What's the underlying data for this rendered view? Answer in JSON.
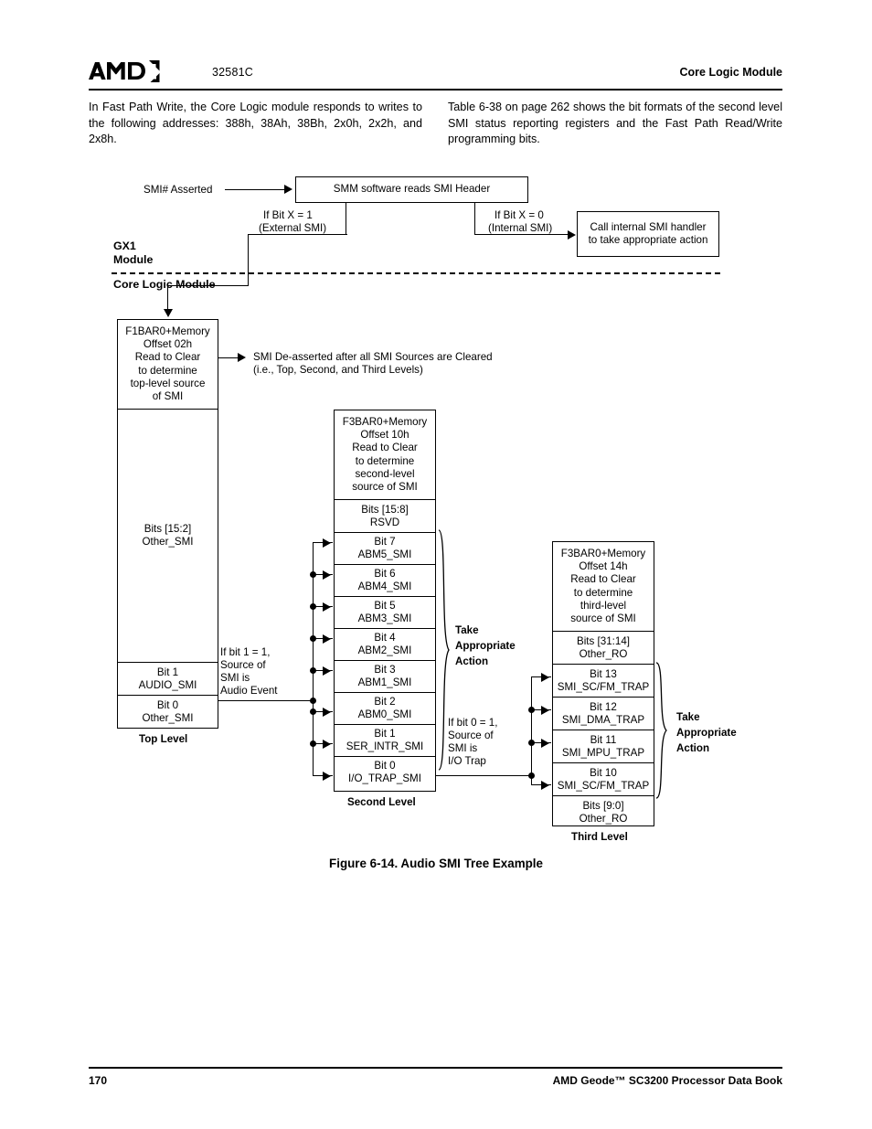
{
  "header": {
    "logo_alt": "AMD",
    "doc_code": "32581C",
    "section_title": "Core Logic Module"
  },
  "intro": {
    "left_paragraph": "In Fast Path Write, the Core Logic module responds to writes to the following addresses: 388h, 38Ah, 38Bh, 2x0h, 2x2h, and 2x8h.",
    "right_paragraph": "Table 6-38 on page 262 shows the bit formats of the second level SMI status reporting registers and the Fast Path Read/Write programming bits."
  },
  "diagram": {
    "smi_asserted_label": "SMI# Asserted",
    "smm_box": "SMM software reads SMI Header",
    "branch_external": "If Bit X = 1\n(External SMI)",
    "branch_external_l1": "If Bit X = 1",
    "branch_external_l2": "(External SMI)",
    "branch_internal_l1": "If Bit X = 0",
    "branch_internal_l2": "(Internal SMI)",
    "internal_handler_l1": "Call internal SMI handler",
    "internal_handler_l2": "to take appropriate action",
    "gx1_module_l1": "GX1",
    "gx1_module_l2": "Module",
    "core_logic_module": "Core Logic Module",
    "deasserted_note_l1": "SMI De-asserted after all SMI Sources are Cleared",
    "deasserted_note_l2": "(i.e., Top, Second, and Third Levels)",
    "audio_note_l1": "If bit 1 = 1,",
    "audio_note_l2": "Source of",
    "audio_note_l3": "SMI is",
    "audio_note_l4": "Audio Event",
    "iotrap_note_l1": "If bit 0 = 1,",
    "iotrap_note_l2": "Source of",
    "iotrap_note_l3": "SMI is",
    "iotrap_note_l4": "I/O Trap",
    "take_action_l1": "Take",
    "take_action_l2": "Appropriate",
    "take_action_l3": "Action",
    "top_level": {
      "caption_title_l1": "F1BAR0+Memory",
      "caption_title_l2": "Offset 02h",
      "caption_body_l1": "Read to Clear",
      "caption_body_l2": "to determine",
      "caption_body_l3": "top-level source",
      "caption_body_l4": "of SMI",
      "rows": [
        {
          "bits": "Bits [15:2]",
          "name": "Other_SMI"
        },
        {
          "bits": "Bit 1",
          "name": "AUDIO_SMI"
        },
        {
          "bits": "Bit 0",
          "name": "Other_SMI"
        }
      ],
      "level_label": "Top Level"
    },
    "second_level": {
      "caption_title_l1": "F3BAR0+Memory",
      "caption_title_l2": "Offset 10h",
      "caption_body_l1": "Read to Clear",
      "caption_body_l2": "to determine",
      "caption_body_l3": "second-level",
      "caption_body_l4": "source of SMI",
      "rows": [
        {
          "bits": "Bits [15:8]",
          "name": "RSVD"
        },
        {
          "bits": "Bit 7",
          "name": "ABM5_SMI"
        },
        {
          "bits": "Bit 6",
          "name": "ABM4_SMI"
        },
        {
          "bits": "Bit 5",
          "name": "ABM3_SMI"
        },
        {
          "bits": "Bit 4",
          "name": "ABM2_SMI"
        },
        {
          "bits": "Bit 3",
          "name": "ABM1_SMI"
        },
        {
          "bits": "Bit 2",
          "name": "ABM0_SMI"
        },
        {
          "bits": "Bit 1",
          "name": "SER_INTR_SMI"
        },
        {
          "bits": "Bit 0",
          "name": "I/O_TRAP_SMI"
        }
      ],
      "level_label": "Second Level"
    },
    "third_level": {
      "caption_title_l1": "F3BAR0+Memory",
      "caption_title_l2": "Offset 14h",
      "caption_body_l1": "Read to Clear",
      "caption_body_l2": "to determine",
      "caption_body_l3": "third-level",
      "caption_body_l4": "source of SMI",
      "rows": [
        {
          "bits": "Bits [31:14]",
          "name": "Other_RO"
        },
        {
          "bits": "Bit 13",
          "name": "SMI_SC/FM_TRAP"
        },
        {
          "bits": "Bit 12",
          "name": "SMI_DMA_TRAP"
        },
        {
          "bits": "Bit 11",
          "name": "SMI_MPU_TRAP"
        },
        {
          "bits": "Bit 10",
          "name": "SMI_SC/FM_TRAP"
        },
        {
          "bits": "Bits [9:0]",
          "name": "Other_RO"
        }
      ],
      "level_label": "Third Level"
    }
  },
  "figure_caption": "Figure 6-14.  Audio SMI Tree Example",
  "footer": {
    "page_number": "170",
    "book_title": "AMD Geode™ SC3200 Processor Data Book"
  }
}
